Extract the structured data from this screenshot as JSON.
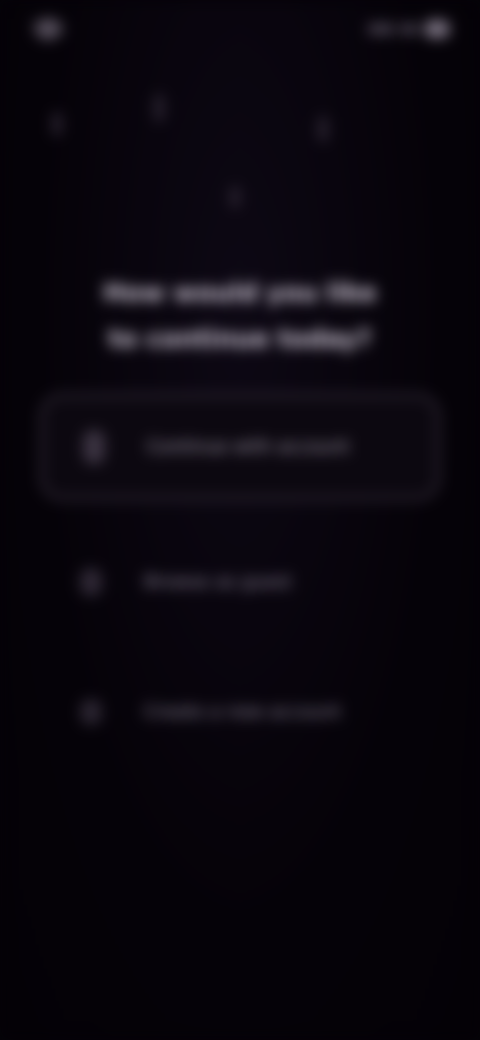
{
  "status_bar": {
    "time": "9:41",
    "icons": [
      "signal-icon",
      "wifi-icon",
      "battery-icon"
    ]
  },
  "question": {
    "line1": "How would you like",
    "line2": "to continue today?"
  },
  "options": [
    {
      "label": "Continue with account",
      "icon": "user-icon",
      "selected": true
    },
    {
      "label": "Browse as guest",
      "icon": "globe-icon",
      "selected": false
    },
    {
      "label": "Create a new account",
      "icon": "plus-icon",
      "selected": false
    }
  ],
  "colors": {
    "background": "#050208",
    "selected_border": "#3c3442",
    "text": "#cfc7d6"
  }
}
